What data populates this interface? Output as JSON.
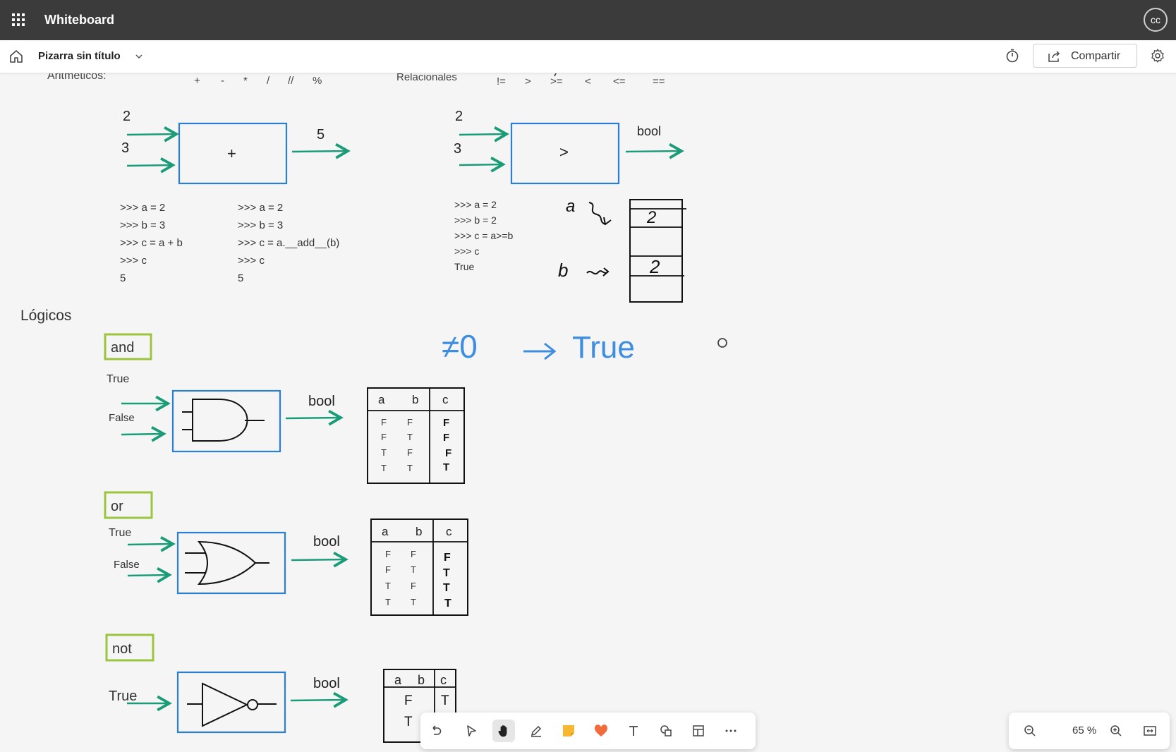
{
  "app": {
    "title": "Whiteboard",
    "avatar_initials": "cc"
  },
  "board": {
    "name": "Pizarra sin título",
    "share_label": "Compartir"
  },
  "zoom": {
    "label": "65 %"
  },
  "canvas": {
    "header": {
      "aritmeticos_label": "Aritmeticos:",
      "arith_ops": [
        "+",
        "-",
        "*",
        "/",
        "//",
        "%"
      ],
      "relacionales_label": "Relacionales",
      "rel_ops": [
        "!=",
        ">",
        ">=",
        "<",
        "<=",
        "=="
      ]
    },
    "sum_diagram": {
      "in_a": "2",
      "in_b": "3",
      "op": "+",
      "out": "5"
    },
    "compare_diagram": {
      "in_a": "2",
      "in_b": "3",
      "op": ">",
      "out": "bool"
    },
    "code_sum_1": [
      ">>> a = 2",
      ">>> b = 3",
      ">>> c = a + b",
      ">>> c",
      "5"
    ],
    "code_sum_2": [
      ">>> a = 2",
      ">>> b = 3",
      ">>> c = a.__add__(b)",
      ">>> c",
      "5"
    ],
    "code_cmp": [
      ">>> a = 2",
      ">>> b = 2",
      ">>> c = a>=b",
      ">>> c",
      "True"
    ],
    "memory": {
      "a_label": "a",
      "b_label": "b",
      "a_value": "2",
      "b_value": "2"
    },
    "logicos_label": "Lógicos",
    "nonzero_note": {
      "lhs": "≠0",
      "rhs": "True"
    },
    "gates": [
      {
        "label": "and",
        "in_a": "True",
        "in_b": "False",
        "out": "bool",
        "headers": [
          "a",
          "b",
          "c"
        ],
        "rows": [
          [
            "F",
            "F",
            "F"
          ],
          [
            "F",
            "T",
            "F"
          ],
          [
            "T",
            "F",
            "F"
          ],
          [
            "T",
            "T",
            "T"
          ]
        ]
      },
      {
        "label": "or",
        "in_a": "True",
        "in_b": "False",
        "out": "bool",
        "headers": [
          "a",
          "b",
          "c"
        ],
        "rows": [
          [
            "F",
            "F",
            "F"
          ],
          [
            "F",
            "T",
            "T"
          ],
          [
            "T",
            "F",
            "T"
          ],
          [
            "T",
            "T",
            "T"
          ]
        ]
      },
      {
        "label": "not",
        "in_a": "True",
        "out": "bool",
        "headers": [
          "a",
          "b",
          "c"
        ],
        "rows": [
          [
            "F",
            "",
            "T"
          ],
          [
            "T",
            "",
            ""
          ]
        ]
      }
    ]
  },
  "toolbar": {
    "tools": [
      "undo-icon",
      "select-icon",
      "hand-icon",
      "pen-icon",
      "note-icon",
      "reaction-icon",
      "text-icon",
      "shapes-icon",
      "template-icon",
      "more-icon"
    ]
  },
  "colors": {
    "topbar": "#3b3b3b",
    "arrow_green": "#1a9c78",
    "box_blue": "#2b7fd0",
    "label_box": "#9bc53d",
    "ink_blue": "#3d8de0"
  }
}
